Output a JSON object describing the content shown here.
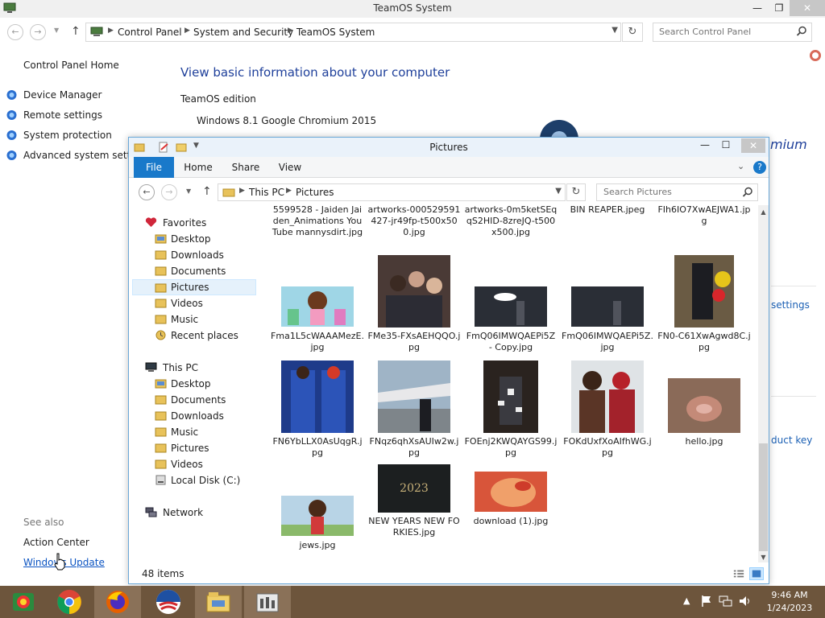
{
  "control_panel": {
    "window_title": "TeamOS System",
    "window_controls": {
      "minimize": "—",
      "maximize": "❐",
      "close": "✕"
    },
    "breadcrumbs": [
      "Control Panel",
      "System and Security",
      "TeamOS System"
    ],
    "search_placeholder": "Search Control Panel",
    "left_home": "Control Panel Home",
    "tasks": [
      "Device Manager",
      "Remote settings",
      "System protection",
      "Advanced system settin"
    ],
    "see_also_label": "See also",
    "see_also_links": [
      "Action Center",
      "Windows Update"
    ],
    "heading": "View basic information about your computer",
    "edition_section": "TeamOS edition",
    "edition_value": "Windows 8.1 Google Chromium 2015",
    "brand_fragment": "mium",
    "settings_fragment": "settings",
    "product_key_fragment": "duct key"
  },
  "explorer": {
    "window_title": "Pictures",
    "window_controls": {
      "minimize": "—",
      "maximize": "☐",
      "close": "✕"
    },
    "ribbon_tabs": [
      "File",
      "Home",
      "Share",
      "View"
    ],
    "breadcrumbs": [
      "This PC",
      "Pictures"
    ],
    "search_placeholder": "Search Pictures",
    "nav": {
      "favorites_label": "Favorites",
      "favorites": [
        "Desktop",
        "Downloads",
        "Documents",
        "Pictures",
        "Videos",
        "Music",
        "Recent places"
      ],
      "thispc_label": "This PC",
      "thispc": [
        "Desktop",
        "Documents",
        "Downloads",
        "Music",
        "Pictures",
        "Videos",
        "Local Disk (C:)"
      ],
      "network_label": "Network",
      "selected": "Pictures"
    },
    "files": [
      {
        "name": "5599528 - Jaiden Jaiden_Animations YouTube mannysdirt.jpg"
      },
      {
        "name": "artworks-000529591427-jr49fp-t500x500.jpg"
      },
      {
        "name": "artworks-0m5ketSEqqS2HID-8zreJQ-t500x500.jpg"
      },
      {
        "name": "BIN REAPER.jpeg"
      },
      {
        "name": "FIh6IO7XwAEJWA1.jpg"
      },
      {
        "name": "Fma1L5cWAAAMezE.jpg"
      },
      {
        "name": "FMe35-FXsAEHQQO.jpg"
      },
      {
        "name": "FmQ06IMWQAEPi5Z - Copy.jpg"
      },
      {
        "name": "FmQ06IMWQAEPi5Z.jpg"
      },
      {
        "name": "FN0-C61XwAgwd8C.jpg"
      },
      {
        "name": "FN6YbLLX0AsUqgR.jpg"
      },
      {
        "name": "FNqz6qhXsAUIw2w.jpg"
      },
      {
        "name": "FOEnj2KWQAYGS99.jpg"
      },
      {
        "name": "FOKdUxfXoAIfhWG.jpg"
      },
      {
        "name": "hello.jpg"
      },
      {
        "name": "jews.jpg"
      },
      {
        "name": "NEW YEARS NEW FORKIES.jpg",
        "thumb_text": "2023"
      },
      {
        "name": "download (1).jpg"
      }
    ],
    "status_count": "48 items"
  },
  "taskbar": {
    "apps": [
      "file-manager-icon",
      "chrome-icon",
      "firefox-icon",
      "obama-icon",
      "file-explorer-icon",
      "control-panel-icon"
    ],
    "clock_time": "9:46 AM",
    "clock_date": "1/24/2023"
  }
}
